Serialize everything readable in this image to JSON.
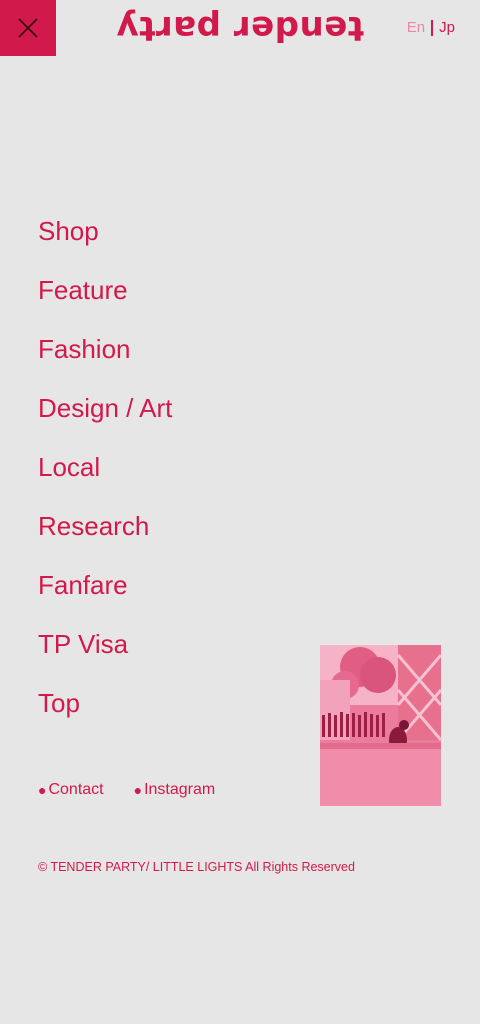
{
  "header": {
    "logo_text": "tender party",
    "lang_en": "En",
    "lang_jp": "Jp"
  },
  "menu": {
    "items": [
      {
        "label": "Shop"
      },
      {
        "label": "Feature"
      },
      {
        "label": "Fashion"
      },
      {
        "label": "Design / Art"
      },
      {
        "label": "Local"
      },
      {
        "label": "Research"
      },
      {
        "label": "Fanfare"
      },
      {
        "label": "TP Visa"
      },
      {
        "label": "Top"
      }
    ]
  },
  "footer": {
    "contact": "Contact",
    "instagram": "Instagram",
    "bullet": "●",
    "copyright": "© TENDER PARTY/ LITTLE LIGHTS All Rights Reserved"
  },
  "colors": {
    "accent": "#d11a4b",
    "background": "#e6e6e6",
    "lang_inactive": "#e98aa6"
  },
  "icons": {
    "close": "close-icon"
  }
}
